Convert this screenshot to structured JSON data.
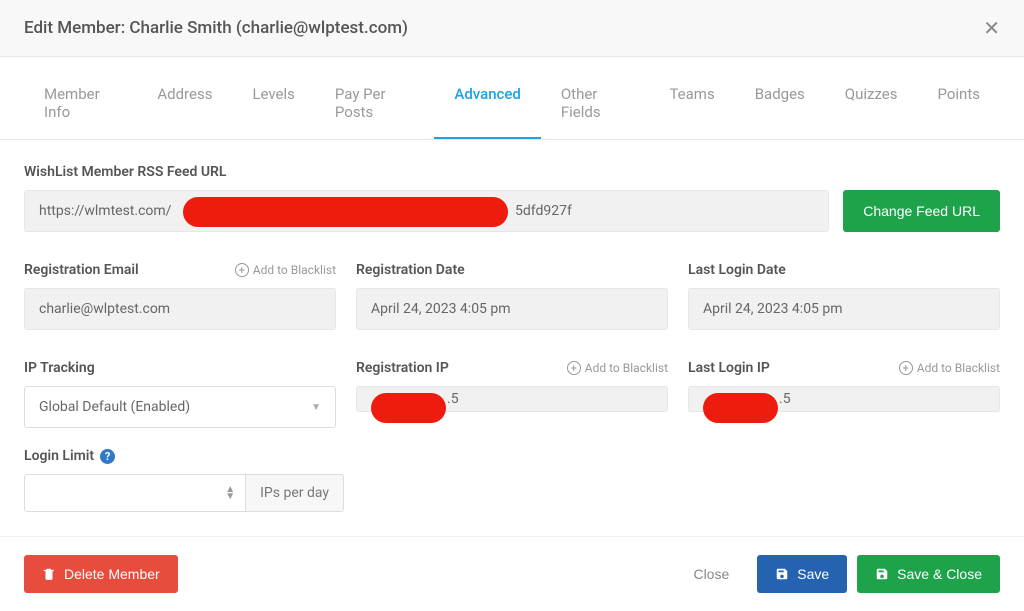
{
  "header": {
    "title": "Edit Member: Charlie Smith (charlie@wlptest.com)"
  },
  "tabs": [
    {
      "label": "Member Info"
    },
    {
      "label": "Address"
    },
    {
      "label": "Levels"
    },
    {
      "label": "Pay Per Posts"
    },
    {
      "label": "Advanced"
    },
    {
      "label": "Other Fields"
    },
    {
      "label": "Teams"
    },
    {
      "label": "Badges"
    },
    {
      "label": "Quizzes"
    },
    {
      "label": "Points"
    }
  ],
  "rss": {
    "label": "WishList Member RSS Feed URL",
    "value_prefix": "https://wlmtest.com/",
    "value_suffix": "5dfd927f",
    "button": "Change Feed URL"
  },
  "fields": {
    "reg_email": {
      "label": "Registration Email",
      "value": "charlie@wlptest.com"
    },
    "reg_date": {
      "label": "Registration Date",
      "value": "April 24, 2023 4:05 pm"
    },
    "last_login_date": {
      "label": "Last Login Date",
      "value": "April 24, 2023 4:05 pm"
    },
    "ip_tracking": {
      "label": "IP Tracking",
      "value": "Global Default (Enabled)"
    },
    "reg_ip": {
      "label": "Registration IP",
      "suffix": ".5"
    },
    "last_login_ip": {
      "label": "Last Login IP",
      "suffix": ".5"
    },
    "login_limit": {
      "label": "Login Limit",
      "unit": "IPs per day"
    }
  },
  "actions": {
    "add_blacklist": "Add to Blacklist",
    "delete": "Delete Member",
    "close": "Close",
    "save": "Save",
    "save_close": "Save & Close"
  }
}
